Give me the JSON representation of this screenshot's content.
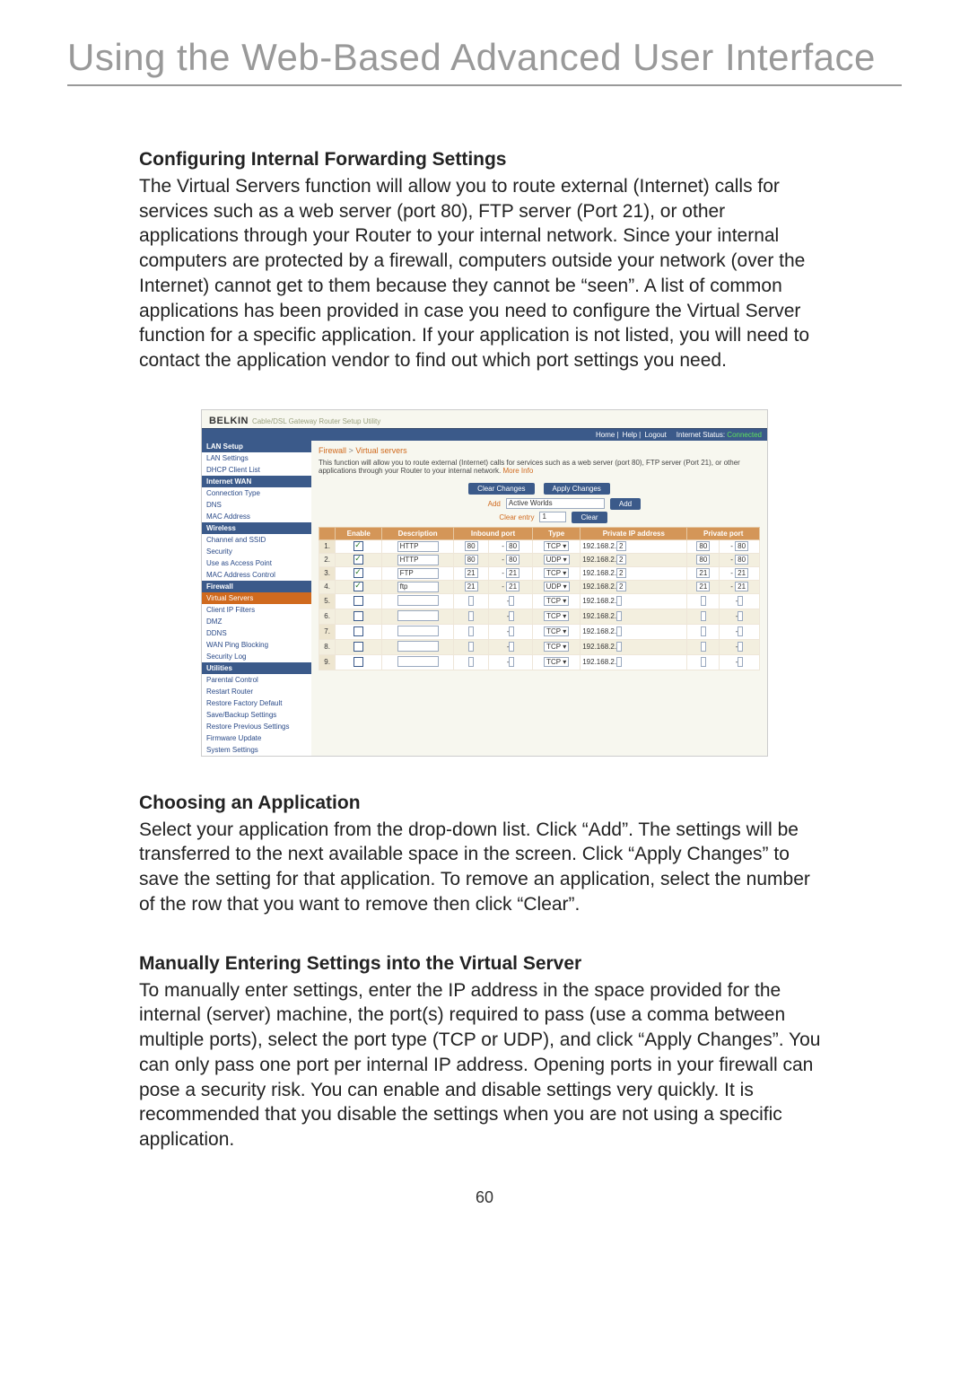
{
  "page": {
    "title": "Using the Web-Based Advanced User Interface",
    "page_number": "60"
  },
  "sections": {
    "s1": {
      "heading": "Configuring Internal Forwarding Settings",
      "body": "The Virtual Servers function will allow you to route external (Internet) calls for services such as a web server (port 80), FTP server (Port 21), or other applications through your Router to your internal network. Since your internal computers are protected by a firewall, computers outside your network (over the Internet) cannot get to them because they cannot be “seen”. A list of common applications has been provided in case you need to configure the Virtual Server function for a specific application. If your application is not listed, you will need to contact the application vendor to find out which port settings you need."
    },
    "s2": {
      "heading": "Choosing an Application",
      "body": "Select your application from the drop-down list. Click “Add”. The settings will be transferred to the next available space in the screen. Click “Apply Changes” to save the setting for that application. To remove an application, select the number of the row that you want to remove then click “Clear”."
    },
    "s3": {
      "heading": "Manually Entering Settings into the Virtual Server",
      "body": "To manually enter settings, enter the IP address in the space provided for the internal (server) machine, the port(s) required to pass (use a comma between multiple ports), select the port type (TCP or UDP), and click “Apply Changes”. You can only pass one port per internal IP address. Opening ports in your firewall can pose a security risk. You can enable and disable settings very quickly. It is recommended that you disable the settings when you are not using a specific application."
    }
  },
  "screenshot": {
    "brand": "BELKIN",
    "brand_sub": "Cable/DSL Gateway Router Setup Utility",
    "topbar": {
      "home": "Home",
      "help": "Help",
      "logout": "Logout",
      "status_label": "Internet Status:",
      "status_value": "Connected"
    },
    "sidenav": {
      "cat1": "LAN Setup",
      "i11": "LAN Settings",
      "i12": "DHCP Client List",
      "cat2": "Internet WAN",
      "i21": "Connection Type",
      "i22": "DNS",
      "i23": "MAC Address",
      "cat3": "Wireless",
      "i31": "Channel and SSID",
      "i32": "Security",
      "i33": "Use as Access Point",
      "i34": "MAC Address Control",
      "cat4": "Firewall",
      "i41": "Virtual Servers",
      "i42": "Client IP Filters",
      "i43": "DMZ",
      "i44": "DDNS",
      "i45": "WAN Ping Blocking",
      "i46": "Security Log",
      "cat5": "Utilities",
      "i51": "Parental Control",
      "i52": "Restart Router",
      "i53": "Restore Factory Default",
      "i54": "Save/Backup Settings",
      "i55": "Restore Previous Settings",
      "i56": "Firmware Update",
      "i57": "System Settings"
    },
    "main": {
      "crumb1": "Firewall",
      "crumb_sep": ">",
      "crumb2": "Virtual servers",
      "intro": "This function will allow you to route external (Internet) calls for services such as a web server (port 80), FTP server (Port 21), or other applications through your Router to your internal network.",
      "more_info": "More Info",
      "btn_clear_changes": "Clear Changes",
      "btn_apply_changes": "Apply Changes",
      "add_label": "Add",
      "add_select": "Active Worlds",
      "btn_add": "Add",
      "clear_label": "Clear entry",
      "clear_select": "1",
      "btn_clear": "Clear",
      "headers": {
        "h_enable": "Enable",
        "h_desc": "Description",
        "h_in": "Inbound port",
        "h_type": "Type",
        "h_ip": "Private IP address",
        "h_pp": "Private port"
      },
      "ip_prefix": "192.168.2.",
      "rows": [
        {
          "n": "1.",
          "en": true,
          "desc": "HTTP",
          "in1": "80",
          "in2": "80",
          "type": "TCP",
          "ip": "2",
          "p1": "80",
          "p2": "80"
        },
        {
          "n": "2.",
          "en": true,
          "desc": "HTTP",
          "in1": "80",
          "in2": "80",
          "type": "UDP",
          "ip": "2",
          "p1": "80",
          "p2": "80"
        },
        {
          "n": "3.",
          "en": true,
          "desc": "FTP",
          "in1": "21",
          "in2": "21",
          "type": "TCP",
          "ip": "2",
          "p1": "21",
          "p2": "21"
        },
        {
          "n": "4.",
          "en": true,
          "desc": "ftp",
          "in1": "21",
          "in2": "21",
          "type": "UDP",
          "ip": "2",
          "p1": "21",
          "p2": "21"
        },
        {
          "n": "5.",
          "en": false,
          "desc": "",
          "in1": "",
          "in2": "",
          "type": "TCP",
          "ip": "",
          "p1": "",
          "p2": ""
        },
        {
          "n": "6.",
          "en": false,
          "desc": "",
          "in1": "",
          "in2": "",
          "type": "TCP",
          "ip": "",
          "p1": "",
          "p2": ""
        },
        {
          "n": "7.",
          "en": false,
          "desc": "",
          "in1": "",
          "in2": "",
          "type": "TCP",
          "ip": "",
          "p1": "",
          "p2": ""
        },
        {
          "n": "8.",
          "en": false,
          "desc": "",
          "in1": "",
          "in2": "",
          "type": "TCP",
          "ip": "",
          "p1": "",
          "p2": ""
        },
        {
          "n": "9.",
          "en": false,
          "desc": "",
          "in1": "",
          "in2": "",
          "type": "TCP",
          "ip": "",
          "p1": "",
          "p2": ""
        }
      ]
    }
  }
}
